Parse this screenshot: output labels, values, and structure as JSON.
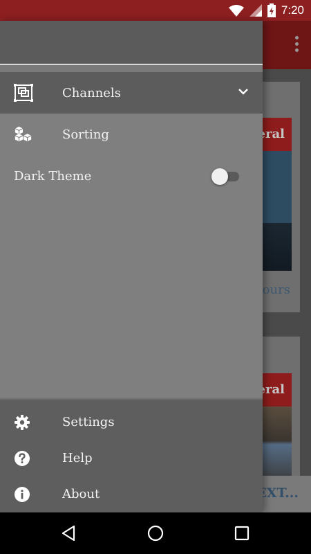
{
  "status_bar": {
    "time": "7:20",
    "icons": [
      "wifi-icon",
      "signal-icon",
      "battery-charging-icon"
    ]
  },
  "background": {
    "card1": {
      "tag": "eral",
      "time": "hours"
    },
    "card2": {
      "tag": "eral"
    },
    "teaser": "EXT..."
  },
  "drawer": {
    "menu": [
      {
        "label": "Channels",
        "icon": "channels-icon",
        "expandable": true
      },
      {
        "label": "Sorting",
        "icon": "cubes-icon"
      }
    ],
    "dark_theme": {
      "label": "Dark Theme",
      "enabled": false
    },
    "footer": [
      {
        "label": "Settings",
        "icon": "gear-icon"
      },
      {
        "label": "Help",
        "icon": "help-icon"
      },
      {
        "label": "About",
        "icon": "info-icon"
      }
    ]
  },
  "nav_bar": {
    "buttons": [
      "back-icon",
      "home-icon",
      "recents-icon"
    ]
  },
  "colors": {
    "status_bar": "#8d1f20",
    "drawer_bg": "#7f7f7f",
    "drawer_header": "#5b5b5b",
    "footer_bg": "#5e5e5e"
  }
}
